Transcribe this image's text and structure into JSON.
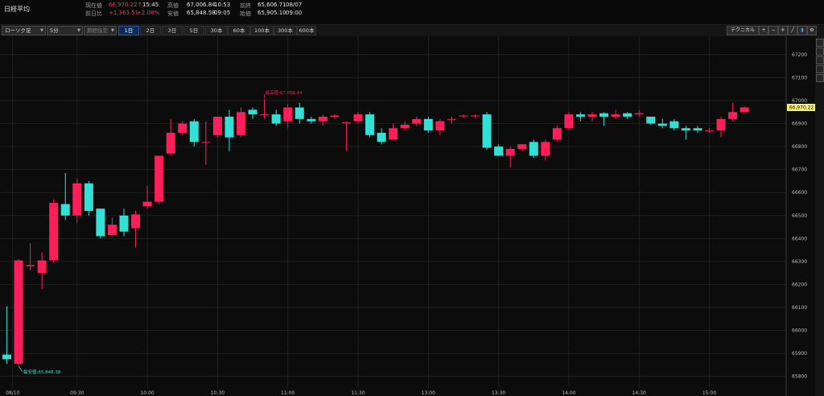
{
  "header": {
    "title": "日経平均",
    "quote": {
      "current_label": "現在値",
      "current_value": "66,970.22",
      "current_time": "15:45",
      "change_label": "前日比",
      "change_value": "+1,363.51",
      "change_pct": "+2.08%",
      "high_label": "高値",
      "high_value": "67,006.84",
      "high_time": "10:53",
      "low_label": "安値",
      "low_value": "65,848.58",
      "low_time": "09:05",
      "prev_close_label": "前終",
      "prev_close_value": "65,606.71",
      "prev_close_date": "08/07",
      "open_label": "始値",
      "open_value": "65,905.10",
      "open_time": "09:00"
    }
  },
  "toolbar": {
    "chart_type": "ローソク足",
    "interval": "5分",
    "period_select": "期間指定",
    "ranges": [
      "1日",
      "2日",
      "3日",
      "5日",
      "30本",
      "60本",
      "100本",
      "300本",
      "600本"
    ],
    "active_range": "1日",
    "technical_label": "テクニカル",
    "icons": [
      "zoom-in-icon",
      "zoom-out-icon",
      "crosshair-icon",
      "line-tool-icon",
      "bar-chart-icon",
      "settings-icon"
    ]
  },
  "colors": {
    "up": "#ff1e5a",
    "down": "#33e0d6",
    "current_label_bg": "#f5f07a",
    "grid": "#2a2a2a"
  },
  "chart_data": {
    "type": "candlestick",
    "ylim": [
      65750,
      67280
    ],
    "yticks": [
      65800,
      65900,
      66000,
      66100,
      66200,
      66300,
      66400,
      66500,
      66600,
      66700,
      66800,
      66900,
      67000,
      67100,
      67200
    ],
    "xticks": [
      {
        "label": "08/10",
        "index": 0.5
      },
      {
        "label": "09:30",
        "index": 6
      },
      {
        "label": "10:00",
        "index": 12
      },
      {
        "label": "10:30",
        "index": 18
      },
      {
        "label": "11:00",
        "index": 24
      },
      {
        "label": "11:30",
        "index": 30
      },
      {
        "label": "13:00",
        "index": 36
      },
      {
        "label": "13:30",
        "index": 42
      },
      {
        "label": "14:00",
        "index": 48
      },
      {
        "label": "14:30",
        "index": 54
      },
      {
        "label": "15:00",
        "index": 60
      }
    ],
    "current_price": "66,970.22",
    "current_value": 66970.22,
    "high_annotation": "最高値:67,006.84",
    "high_value": 67006.84,
    "high_index": 22,
    "low_annotation": "最安値:65,848.38",
    "low_value": 65848.38,
    "low_index": 1,
    "candles": [
      {
        "o": 65895,
        "c": 65875,
        "h": 66105,
        "l": 65855
      },
      {
        "o": 65855,
        "c": 66305,
        "h": 66310,
        "l": 65848.38
      },
      {
        "o": 66280,
        "c": 66285,
        "h": 66380,
        "l": 66260
      },
      {
        "o": 66250,
        "c": 66305,
        "h": 66340,
        "l": 66180
      },
      {
        "o": 66305,
        "c": 66555,
        "h": 66570,
        "l": 66295
      },
      {
        "o": 66550,
        "c": 66500,
        "h": 66685,
        "l": 66480
      },
      {
        "o": 66500,
        "c": 66640,
        "h": 66660,
        "l": 66470
      },
      {
        "o": 66640,
        "c": 66520,
        "h": 66650,
        "l": 66500
      },
      {
        "o": 66530,
        "c": 66410,
        "h": 66530,
        "l": 66400
      },
      {
        "o": 66415,
        "c": 66460,
        "h": 66490,
        "l": 66420
      },
      {
        "o": 66500,
        "c": 66430,
        "h": 66530,
        "l": 66410
      },
      {
        "o": 66445,
        "c": 66505,
        "h": 66520,
        "l": 66360
      },
      {
        "o": 66540,
        "c": 66560,
        "h": 66630,
        "l": 66530
      },
      {
        "o": 66560,
        "c": 66760,
        "h": 66760,
        "l": 66550
      },
      {
        "o": 66770,
        "c": 66860,
        "h": 66920,
        "l": 66760
      },
      {
        "o": 66860,
        "c": 66900,
        "h": 66910,
        "l": 66850
      },
      {
        "o": 66910,
        "c": 66820,
        "h": 66920,
        "l": 66800
      },
      {
        "o": 66820,
        "c": 66820,
        "h": 66910,
        "l": 66720
      },
      {
        "o": 66850,
        "c": 66930,
        "h": 66930,
        "l": 66840
      },
      {
        "o": 66930,
        "c": 66840,
        "h": 66960,
        "l": 66780
      },
      {
        "o": 66850,
        "c": 66950,
        "h": 66970,
        "l": 66840
      },
      {
        "o": 66960,
        "c": 66940,
        "h": 66970,
        "l": 66920
      },
      {
        "o": 66940,
        "c": 66940,
        "h": 67006.84,
        "l": 66920
      },
      {
        "o": 66940,
        "c": 66900,
        "h": 66960,
        "l": 66890
      },
      {
        "o": 66910,
        "c": 66970,
        "h": 66985,
        "l": 66880
      },
      {
        "o": 66970,
        "c": 66920,
        "h": 66990,
        "l": 66900
      },
      {
        "o": 66920,
        "c": 66910,
        "h": 66930,
        "l": 66900
      },
      {
        "o": 66910,
        "c": 66930,
        "h": 66940,
        "l": 66890
      },
      {
        "o": 66930,
        "c": 66935,
        "h": 66940,
        "l": 66920
      },
      {
        "o": 66905,
        "c": 66905,
        "h": 66910,
        "l": 66780
      },
      {
        "o": 66910,
        "c": 66940,
        "h": 66950,
        "l": 66900
      },
      {
        "o": 66940,
        "c": 66850,
        "h": 66950,
        "l": 66840
      },
      {
        "o": 66860,
        "c": 66820,
        "h": 66880,
        "l": 66810
      },
      {
        "o": 66830,
        "c": 66880,
        "h": 66900,
        "l": 66830
      },
      {
        "o": 66880,
        "c": 66895,
        "h": 66910,
        "l": 66870
      },
      {
        "o": 66900,
        "c": 66920,
        "h": 66930,
        "l": 66890
      },
      {
        "o": 66920,
        "c": 66870,
        "h": 66930,
        "l": 66860
      },
      {
        "o": 66870,
        "c": 66910,
        "h": 66920,
        "l": 66850
      },
      {
        "o": 66920,
        "c": 66920,
        "h": 66930,
        "l": 66900
      },
      {
        "o": 66935,
        "c": 66935,
        "h": 66940,
        "l": 66925
      },
      {
        "o": 66935,
        "c": 66935,
        "h": 66940,
        "l": 66925
      },
      {
        "o": 66940,
        "c": 66795,
        "h": 66950,
        "l": 66785
      },
      {
        "o": 66800,
        "c": 66760,
        "h": 66810,
        "l": 66760
      },
      {
        "o": 66760,
        "c": 66790,
        "h": 66800,
        "l": 66710
      },
      {
        "o": 66790,
        "c": 66810,
        "h": 66810,
        "l": 66780
      },
      {
        "o": 66820,
        "c": 66760,
        "h": 66830,
        "l": 66750
      },
      {
        "o": 66760,
        "c": 66820,
        "h": 66830,
        "l": 66740
      },
      {
        "o": 66830,
        "c": 66880,
        "h": 66890,
        "l": 66820
      },
      {
        "o": 66880,
        "c": 66940,
        "h": 66950,
        "l": 66870
      },
      {
        "o": 66940,
        "c": 66930,
        "h": 66950,
        "l": 66910
      },
      {
        "o": 66930,
        "c": 66940,
        "h": 66950,
        "l": 66910
      },
      {
        "o": 66945,
        "c": 66930,
        "h": 66950,
        "l": 66890
      },
      {
        "o": 66930,
        "c": 66940,
        "h": 66960,
        "l": 66920
      },
      {
        "o": 66945,
        "c": 66930,
        "h": 66950,
        "l": 66920
      },
      {
        "o": 66940,
        "c": 66945,
        "h": 66960,
        "l": 66930
      },
      {
        "o": 66930,
        "c": 66900,
        "h": 66930,
        "l": 66895
      },
      {
        "o": 66900,
        "c": 66890,
        "h": 66920,
        "l": 66880
      },
      {
        "o": 66910,
        "c": 66880,
        "h": 66920,
        "l": 66870
      },
      {
        "o": 66880,
        "c": 66870,
        "h": 66890,
        "l": 66830
      },
      {
        "o": 66880,
        "c": 66870,
        "h": 66890,
        "l": 66860
      },
      {
        "o": 66870,
        "c": 66870,
        "h": 66880,
        "l": 66860
      },
      {
        "o": 66870,
        "c": 66920,
        "h": 66930,
        "l": 66840
      },
      {
        "o": 66920,
        "c": 66950,
        "h": 66990,
        "l": 66910
      },
      {
        "o": 66950,
        "c": 66970.22,
        "h": 66975,
        "l": 66950
      }
    ]
  }
}
